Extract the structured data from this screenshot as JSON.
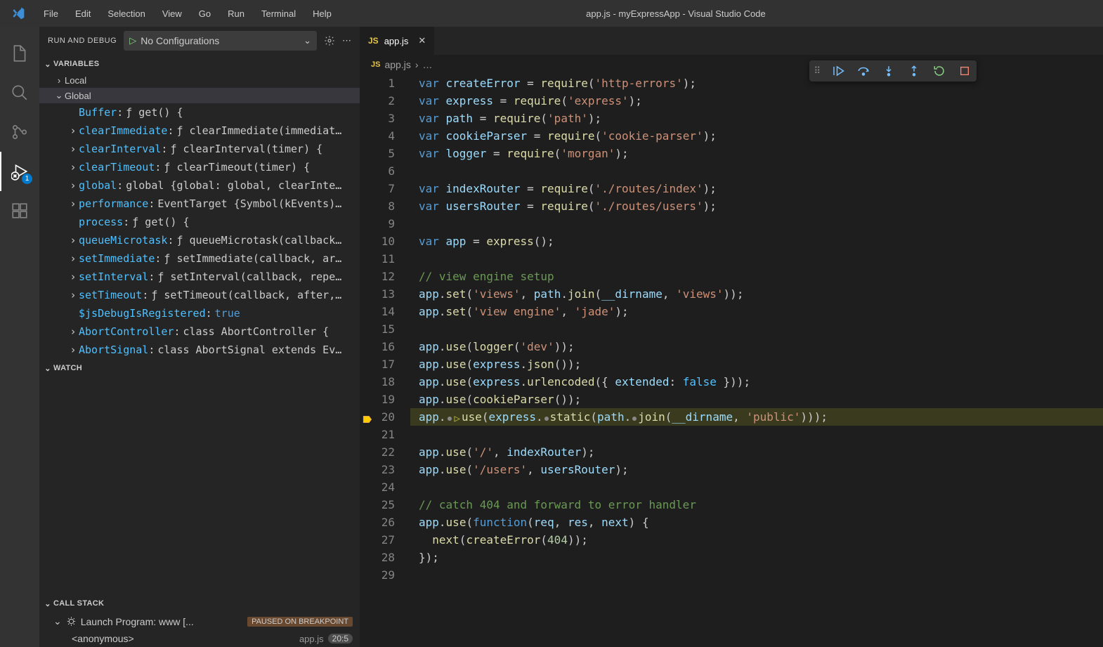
{
  "window": {
    "title": "app.js - myExpressApp - Visual Studio Code"
  },
  "menus": [
    "File",
    "Edit",
    "Selection",
    "View",
    "Go",
    "Run",
    "Terminal",
    "Help"
  ],
  "activityBar": {
    "items": [
      "files",
      "search",
      "scm",
      "debug",
      "extensions"
    ],
    "active": "debug",
    "debugBadge": "1"
  },
  "sidebar": {
    "title": "RUN AND DEBUG",
    "config": {
      "play": "▷",
      "label": "No Configurations",
      "chevron": "⌄"
    },
    "sections": {
      "variables": {
        "title": "VARIABLES",
        "scopes": {
          "local": {
            "label": "Local",
            "expanded": false
          },
          "global": {
            "label": "Global",
            "expanded": true,
            "items": [
              {
                "name": "Buffer",
                "sep": ":",
                "value": "ƒ get() {",
                "expandable": false,
                "plain": true
              },
              {
                "name": "clearImmediate",
                "sep": ":",
                "value": "ƒ clearImmediate(immediat…",
                "expandable": true
              },
              {
                "name": "clearInterval",
                "sep": ":",
                "value": "ƒ clearInterval(timer) {",
                "expandable": true
              },
              {
                "name": "clearTimeout",
                "sep": ":",
                "value": "ƒ clearTimeout(timer) {",
                "expandable": true
              },
              {
                "name": "global",
                "sep": ":",
                "value": "global {global: global, clearInte…",
                "expandable": true,
                "nofn": true
              },
              {
                "name": "performance",
                "sep": ":",
                "value": "EventTarget {Symbol(kEvents)…",
                "expandable": true,
                "nofn": true
              },
              {
                "name": "process",
                "sep": ":",
                "value": "ƒ get() {",
                "expandable": false,
                "plain": true
              },
              {
                "name": "queueMicrotask",
                "sep": ":",
                "value": "ƒ queueMicrotask(callback…",
                "expandable": true
              },
              {
                "name": "setImmediate",
                "sep": ":",
                "value": "ƒ setImmediate(callback, ar…",
                "expandable": true
              },
              {
                "name": "setInterval",
                "sep": ":",
                "value": "ƒ setInterval(callback, repe…",
                "expandable": true
              },
              {
                "name": "setTimeout",
                "sep": ":",
                "value": "ƒ setTimeout(callback, after,…",
                "expandable": true
              },
              {
                "name": "$jsDebugIsRegistered",
                "sep": ":",
                "value": "true",
                "expandable": false,
                "plain": true,
                "bool": true
              },
              {
                "name": "AbortController",
                "sep": ":",
                "value": "class AbortController {",
                "expandable": true,
                "nofn": true
              },
              {
                "name": "AbortSignal",
                "sep": ":",
                "value": "class AbortSignal extends Ev…",
                "expandable": true,
                "nofn": true
              }
            ]
          }
        }
      },
      "watch": {
        "title": "WATCH"
      },
      "callstack": {
        "title": "CALL STACK",
        "program": {
          "label": "Launch Program: www [...",
          "status": "PAUSED ON BREAKPOINT"
        },
        "frame": {
          "label": "<anonymous>",
          "file": "app.js",
          "loc": "20:5"
        }
      }
    }
  },
  "tabs": [
    {
      "icon": "JS",
      "label": "app.js"
    }
  ],
  "breadcrumb": {
    "icon": "JS",
    "file": "app.js",
    "sep": "›",
    "more": "…"
  },
  "debugToolbar": [
    "grip",
    "continue",
    "step-over",
    "step-into",
    "step-out",
    "restart",
    "stop"
  ],
  "code": {
    "breakpointLine": 20,
    "lines": [
      {
        "n": 1,
        "h": [
          [
            "k",
            "var "
          ],
          [
            "v",
            "createError"
          ],
          [
            "p",
            " = "
          ],
          [
            "fn",
            "require"
          ],
          [
            "p",
            "("
          ],
          [
            "s",
            "'http-errors'"
          ],
          [
            "p",
            ");"
          ]
        ]
      },
      {
        "n": 2,
        "h": [
          [
            "k",
            "var "
          ],
          [
            "v",
            "express"
          ],
          [
            "p",
            " = "
          ],
          [
            "fn",
            "require"
          ],
          [
            "p",
            "("
          ],
          [
            "s",
            "'express'"
          ],
          [
            "p",
            ");"
          ]
        ]
      },
      {
        "n": 3,
        "h": [
          [
            "k",
            "var "
          ],
          [
            "v",
            "path"
          ],
          [
            "p",
            " = "
          ],
          [
            "fn",
            "require"
          ],
          [
            "p",
            "("
          ],
          [
            "s",
            "'path'"
          ],
          [
            "p",
            ");"
          ]
        ]
      },
      {
        "n": 4,
        "h": [
          [
            "k",
            "var "
          ],
          [
            "v",
            "cookieParser"
          ],
          [
            "p",
            " = "
          ],
          [
            "fn",
            "require"
          ],
          [
            "p",
            "("
          ],
          [
            "s",
            "'cookie-parser'"
          ],
          [
            "p",
            ");"
          ]
        ]
      },
      {
        "n": 5,
        "h": [
          [
            "k",
            "var "
          ],
          [
            "v",
            "logger"
          ],
          [
            "p",
            " = "
          ],
          [
            "fn",
            "require"
          ],
          [
            "p",
            "("
          ],
          [
            "s",
            "'morgan'"
          ],
          [
            "p",
            ");"
          ]
        ]
      },
      {
        "n": 6,
        "h": []
      },
      {
        "n": 7,
        "h": [
          [
            "k",
            "var "
          ],
          [
            "v",
            "indexRouter"
          ],
          [
            "p",
            " = "
          ],
          [
            "fn",
            "require"
          ],
          [
            "p",
            "("
          ],
          [
            "s",
            "'./routes/index'"
          ],
          [
            "p",
            ");"
          ]
        ]
      },
      {
        "n": 8,
        "h": [
          [
            "k",
            "var "
          ],
          [
            "v",
            "usersRouter"
          ],
          [
            "p",
            " = "
          ],
          [
            "fn",
            "require"
          ],
          [
            "p",
            "("
          ],
          [
            "s",
            "'./routes/users'"
          ],
          [
            "p",
            ");"
          ]
        ]
      },
      {
        "n": 9,
        "h": []
      },
      {
        "n": 10,
        "h": [
          [
            "k",
            "var "
          ],
          [
            "v",
            "app"
          ],
          [
            "p",
            " = "
          ],
          [
            "fn",
            "express"
          ],
          [
            "p",
            "();"
          ]
        ]
      },
      {
        "n": 11,
        "h": []
      },
      {
        "n": 12,
        "h": [
          [
            "c",
            "// view engine setup"
          ]
        ]
      },
      {
        "n": 13,
        "h": [
          [
            "v",
            "app"
          ],
          [
            "p",
            "."
          ],
          [
            "fn",
            "set"
          ],
          [
            "p",
            "("
          ],
          [
            "s",
            "'views'"
          ],
          [
            "p",
            ", "
          ],
          [
            "v",
            "path"
          ],
          [
            "p",
            "."
          ],
          [
            "fn",
            "join"
          ],
          [
            "p",
            "("
          ],
          [
            "v",
            "__dirname"
          ],
          [
            "p",
            ", "
          ],
          [
            "s",
            "'views'"
          ],
          [
            "p",
            "));"
          ]
        ]
      },
      {
        "n": 14,
        "h": [
          [
            "v",
            "app"
          ],
          [
            "p",
            "."
          ],
          [
            "fn",
            "set"
          ],
          [
            "p",
            "("
          ],
          [
            "s",
            "'view engine'"
          ],
          [
            "p",
            ", "
          ],
          [
            "s",
            "'jade'"
          ],
          [
            "p",
            ");"
          ]
        ]
      },
      {
        "n": 15,
        "h": []
      },
      {
        "n": 16,
        "h": [
          [
            "v",
            "app"
          ],
          [
            "p",
            "."
          ],
          [
            "fn",
            "use"
          ],
          [
            "p",
            "("
          ],
          [
            "fn",
            "logger"
          ],
          [
            "p",
            "("
          ],
          [
            "s",
            "'dev'"
          ],
          [
            "p",
            "));"
          ]
        ]
      },
      {
        "n": 17,
        "h": [
          [
            "v",
            "app"
          ],
          [
            "p",
            "."
          ],
          [
            "fn",
            "use"
          ],
          [
            "p",
            "("
          ],
          [
            "v",
            "express"
          ],
          [
            "p",
            "."
          ],
          [
            "fn",
            "json"
          ],
          [
            "p",
            "());"
          ]
        ]
      },
      {
        "n": 18,
        "h": [
          [
            "v",
            "app"
          ],
          [
            "p",
            "."
          ],
          [
            "fn",
            "use"
          ],
          [
            "p",
            "("
          ],
          [
            "v",
            "express"
          ],
          [
            "p",
            "."
          ],
          [
            "fn",
            "urlencoded"
          ],
          [
            "p",
            "({ "
          ],
          [
            "v",
            "extended"
          ],
          [
            "p",
            ": "
          ],
          [
            "cn",
            "false"
          ],
          [
            "p",
            " }));"
          ]
        ]
      },
      {
        "n": 19,
        "h": [
          [
            "v",
            "app"
          ],
          [
            "p",
            "."
          ],
          [
            "fn",
            "use"
          ],
          [
            "p",
            "("
          ],
          [
            "fn",
            "cookieParser"
          ],
          [
            "p",
            "());"
          ]
        ]
      },
      {
        "n": 20,
        "hl": true,
        "h": [
          [
            "v",
            "app"
          ],
          [
            "p",
            "."
          ],
          [
            "hint",
            ""
          ],
          [
            "fn",
            "use"
          ],
          [
            "p",
            "("
          ],
          [
            "v",
            "express"
          ],
          [
            "p",
            "."
          ],
          [
            "hint",
            ""
          ],
          [
            "fn",
            "static"
          ],
          [
            "p",
            "("
          ],
          [
            "v",
            "path"
          ],
          [
            "p",
            "."
          ],
          [
            "hint",
            ""
          ],
          [
            "fn",
            "join"
          ],
          [
            "p",
            "("
          ],
          [
            "v",
            "__dirname"
          ],
          [
            "p",
            ", "
          ],
          [
            "s",
            "'public'"
          ],
          [
            "p",
            ")));"
          ]
        ]
      },
      {
        "n": 21,
        "h": []
      },
      {
        "n": 22,
        "h": [
          [
            "v",
            "app"
          ],
          [
            "p",
            "."
          ],
          [
            "fn",
            "use"
          ],
          [
            "p",
            "("
          ],
          [
            "s",
            "'/'"
          ],
          [
            "p",
            ", "
          ],
          [
            "v",
            "indexRouter"
          ],
          [
            "p",
            ");"
          ]
        ]
      },
      {
        "n": 23,
        "h": [
          [
            "v",
            "app"
          ],
          [
            "p",
            "."
          ],
          [
            "fn",
            "use"
          ],
          [
            "p",
            "("
          ],
          [
            "s",
            "'/users'"
          ],
          [
            "p",
            ", "
          ],
          [
            "v",
            "usersRouter"
          ],
          [
            "p",
            ");"
          ]
        ]
      },
      {
        "n": 24,
        "h": []
      },
      {
        "n": 25,
        "h": [
          [
            "c",
            "// catch 404 and forward to error handler"
          ]
        ]
      },
      {
        "n": 26,
        "h": [
          [
            "v",
            "app"
          ],
          [
            "p",
            "."
          ],
          [
            "fn",
            "use"
          ],
          [
            "p",
            "("
          ],
          [
            "k",
            "function"
          ],
          [
            "p",
            "("
          ],
          [
            "v",
            "req"
          ],
          [
            "p",
            ", "
          ],
          [
            "v",
            "res"
          ],
          [
            "p",
            ", "
          ],
          [
            "v",
            "next"
          ],
          [
            "p",
            ") {"
          ]
        ]
      },
      {
        "n": 27,
        "h": [
          [
            "p",
            "  "
          ],
          [
            "fn",
            "next"
          ],
          [
            "p",
            "("
          ],
          [
            "fn",
            "createError"
          ],
          [
            "p",
            "("
          ],
          [
            "n",
            "404"
          ],
          [
            "p",
            "));"
          ]
        ]
      },
      {
        "n": 28,
        "h": [
          [
            "p",
            "});"
          ]
        ]
      },
      {
        "n": 29,
        "h": []
      }
    ]
  }
}
